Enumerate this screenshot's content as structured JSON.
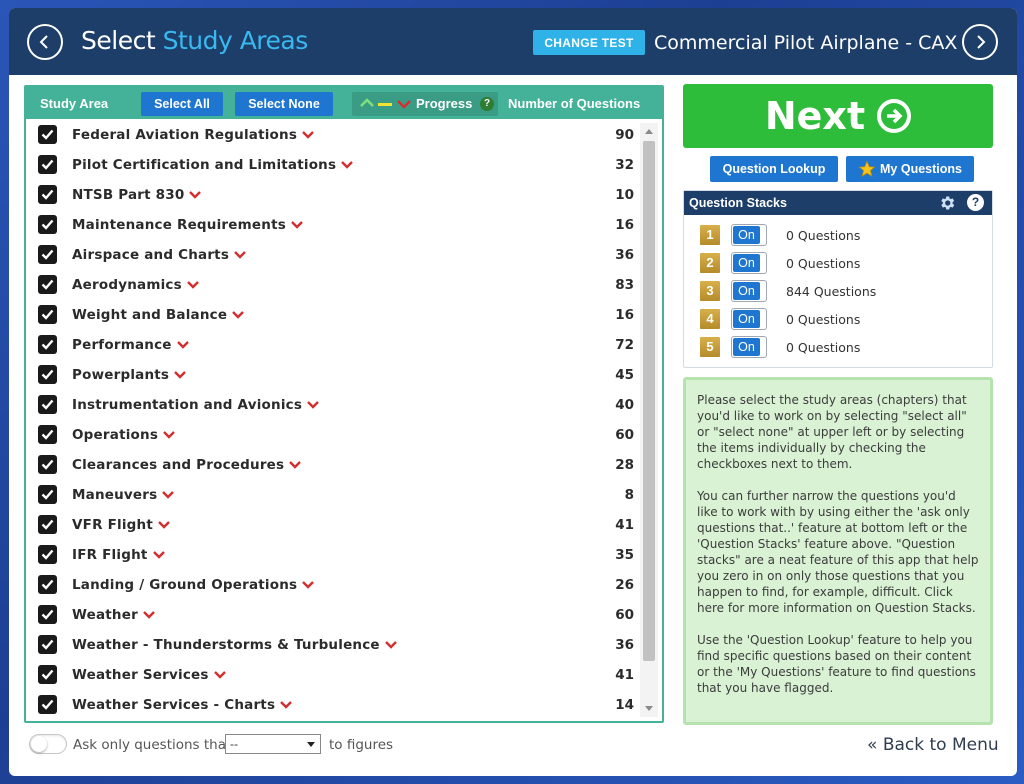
{
  "header": {
    "title_prefix": "Select",
    "title_accent": "Study Areas",
    "change_test_label": "CHANGE TEST",
    "test_name": "Commercial Pilot Airplane - CAX"
  },
  "table": {
    "col_study_area": "Study Area",
    "select_all": "Select All",
    "select_none": "Select None",
    "col_progress": "Progress",
    "progress_help": "?",
    "col_num_questions": "Number of Questions",
    "rows": [
      {
        "name": "Federal Aviation Regulations",
        "count": "90",
        "checked": true
      },
      {
        "name": "Pilot Certification and Limitations",
        "count": "32",
        "checked": true
      },
      {
        "name": "NTSB Part 830",
        "count": "10",
        "checked": true
      },
      {
        "name": "Maintenance Requirements",
        "count": "16",
        "checked": true
      },
      {
        "name": "Airspace and Charts",
        "count": "36",
        "checked": true
      },
      {
        "name": "Aerodynamics",
        "count": "83",
        "checked": true
      },
      {
        "name": "Weight and Balance",
        "count": "16",
        "checked": true
      },
      {
        "name": "Performance",
        "count": "72",
        "checked": true
      },
      {
        "name": "Powerplants",
        "count": "45",
        "checked": true
      },
      {
        "name": "Instrumentation and Avionics",
        "count": "40",
        "checked": true
      },
      {
        "name": "Operations",
        "count": "60",
        "checked": true
      },
      {
        "name": "Clearances and Procedures",
        "count": "28",
        "checked": true
      },
      {
        "name": "Maneuvers",
        "count": "8",
        "checked": true
      },
      {
        "name": "VFR Flight",
        "count": "41",
        "checked": true
      },
      {
        "name": "IFR Flight",
        "count": "35",
        "checked": true
      },
      {
        "name": "Landing / Ground Operations",
        "count": "26",
        "checked": true
      },
      {
        "name": "Weather",
        "count": "60",
        "checked": true
      },
      {
        "name": "Weather - Thunderstorms & Turbulence",
        "count": "36",
        "checked": true
      },
      {
        "name": "Weather Services",
        "count": "41",
        "checked": true
      },
      {
        "name": "Weather Services - Charts",
        "count": "14",
        "checked": true
      }
    ]
  },
  "filter": {
    "ask_label": "Ask only questions that",
    "select_value": "--",
    "to_figures": "to figures"
  },
  "right": {
    "next_label": "Next",
    "question_lookup": "Question Lookup",
    "my_questions": "My Questions",
    "stacks_title": "Question Stacks",
    "help": "?",
    "stacks": [
      {
        "num": "1",
        "toggle": "On",
        "text": "0 Questions"
      },
      {
        "num": "2",
        "toggle": "On",
        "text": "0 Questions"
      },
      {
        "num": "3",
        "toggle": "On",
        "text": "844 Questions"
      },
      {
        "num": "4",
        "toggle": "On",
        "text": "0 Questions"
      },
      {
        "num": "5",
        "toggle": "On",
        "text": "0 Questions"
      }
    ],
    "info_p1": "Please select the study areas (chapters) that you'd like to work on by selecting \"select all\" or \"select none\" at upper left or by selecting the items individually by checking the checkboxes next to them.",
    "info_p2": "You can further narrow the questions you'd like to work with by using either the 'ask only questions that..' feature at bottom left or the 'Question Stacks' feature above. \"Question stacks\" are a neat feature of this app that help you zero in on only those questions that you happen to find, for example, difficult. Click here for more information on Question Stacks.",
    "info_p3": "Use the 'Question Lookup' feature to help you find specific questions based on their content or the 'My Questions' feature to find questions that you have flagged.",
    "back_to_menu": "Back to Menu"
  },
  "colors": {
    "header_bg": "#1c3e69",
    "accent_blue": "#3ab8f0",
    "teal": "#43b298",
    "button_blue": "#1e76d0",
    "next_green": "#2ebd3a",
    "chevron_red": "#d32f2f",
    "stack_gold": "#c89d38",
    "info_bg": "#d9f2d4"
  }
}
